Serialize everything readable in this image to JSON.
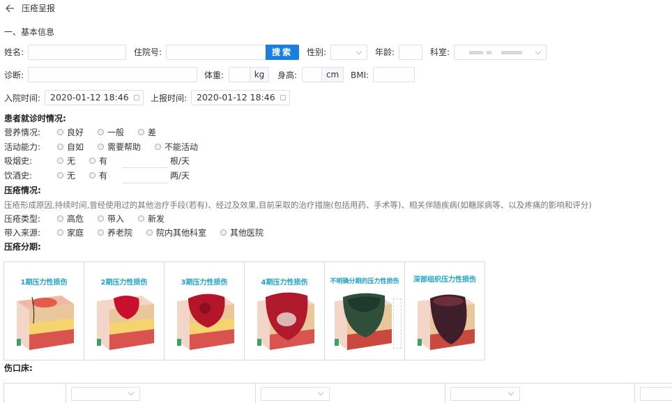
{
  "header": {
    "back_icon": "back-arrow-icon",
    "title": "压疮呈报"
  },
  "section_basic": "一、基本信息",
  "basic": {
    "name_label": "姓名:",
    "name_value": "",
    "inpatient_label": "住院号:",
    "inpatient_value": "",
    "search_button": "搜索",
    "gender_label": "性别:",
    "gender_value": "",
    "age_label": "年龄:",
    "age_value": "",
    "dept_label": "科室:",
    "diagnosis_label": "诊断:",
    "diagnosis_value": "",
    "weight_label": "体重:",
    "weight_unit": "kg",
    "height_label": "身高:",
    "height_unit": "cm",
    "bmi_label": "BMI:",
    "admit_time_label": "入院时间:",
    "admit_time_value": "2020-01-12 18:46",
    "report_time_label": "上报时间:",
    "report_time_value": "2020-01-12 18:46"
  },
  "visit": {
    "heading": "患者就诊时情况:",
    "nutrition_label": "营养情况:",
    "nutrition_options": [
      "良好",
      "一般",
      "差"
    ],
    "activity_label": "活动能力:",
    "activity_options": [
      "自如",
      "需要帮助",
      "不能活动"
    ],
    "smoking_label": "吸烟史:",
    "smoking_options": [
      "无",
      "有"
    ],
    "smoking_unit": "根/天",
    "drinking_label": "饮酒史:",
    "drinking_options": [
      "无",
      "有"
    ],
    "drinking_unit": "两/天"
  },
  "ulcer": {
    "heading": "压疮情况:",
    "description": "压疮形成原因,持续时间,曾经使用过的其他治疗手段(若有)、经过及效果,目前采取的治疗措施(包括用药、手术等)、相关伴随疾病(如糖尿病等、以及疼痛的影响和评分)",
    "type_label": "压疮类型:",
    "type_options": [
      "高危",
      "带入",
      "新发"
    ],
    "source_label": "带入来源:",
    "source_options": [
      "家庭",
      "养老院",
      "院内其他科室",
      "其他医院"
    ],
    "stage_heading": "压疮分期:",
    "stages": [
      "1期压力性损伤",
      "2期压力性损伤",
      "3期压力性损伤",
      "4期压力性损伤",
      "不明确分期的压力性损伤",
      "深部组织压力性损伤"
    ]
  },
  "wound_bed": {
    "heading": "伤口床:"
  },
  "colors": {
    "accent": "#1a7fe0",
    "stage_title": "#1fa3c8",
    "border": "#dcdfe6"
  }
}
